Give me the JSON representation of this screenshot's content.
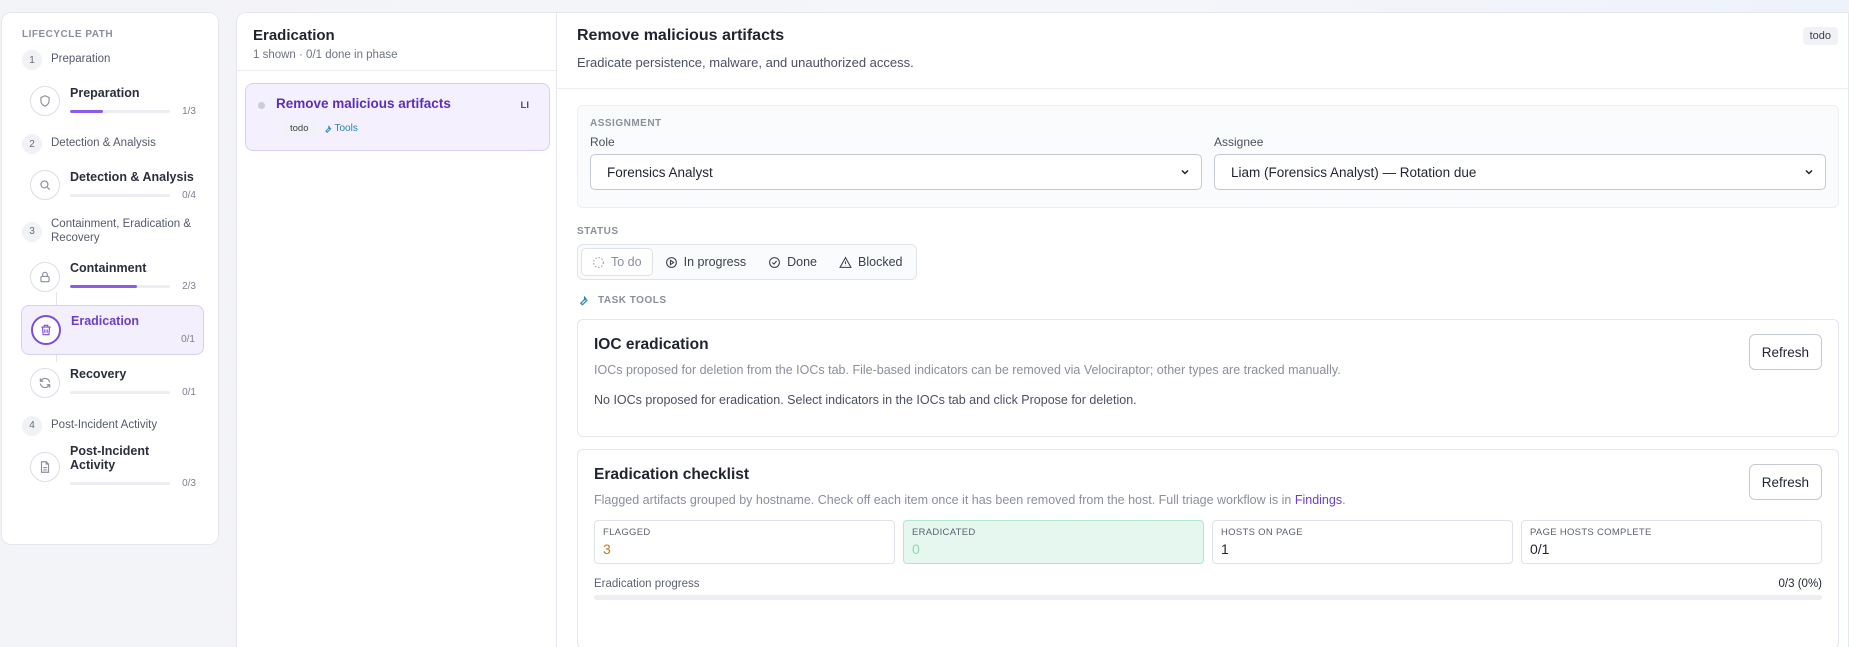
{
  "sidebar": {
    "title": "LIFECYCLE PATH",
    "phases": [
      {
        "num": "1",
        "name": "Preparation"
      },
      {
        "num": "2",
        "name": "Detection & Analysis"
      },
      {
        "num": "3",
        "name": "Containment, Eradication & Recovery"
      },
      {
        "num": "4",
        "name": "Post-Incident Activity"
      }
    ],
    "steps": [
      {
        "label": "Preparation",
        "count": "1/3",
        "progress": 0.33,
        "icon": "shield-icon"
      },
      {
        "label": "Detection & Analysis",
        "count": "0/4",
        "progress": 0,
        "icon": "search-icon"
      },
      {
        "label": "Containment",
        "count": "2/3",
        "progress": 0.67,
        "icon": "lock-icon"
      },
      {
        "label": "Eradication",
        "count": "0/1",
        "progress": 0,
        "icon": "trash-icon",
        "active": true
      },
      {
        "label": "Recovery",
        "count": "0/1",
        "progress": 0,
        "icon": "refresh-icon"
      },
      {
        "label": "Post-Incident Activity",
        "count": "0/3",
        "progress": 0,
        "icon": "document-icon"
      }
    ]
  },
  "tasks": {
    "title": "Eradication",
    "subtitle": "1 shown · 0/1 done in phase",
    "items": [
      {
        "name": "Remove malicious artifacts",
        "initials": "LI",
        "status": "todo",
        "tools": "Tools"
      }
    ]
  },
  "detail": {
    "title": "Remove malicious artifacts",
    "description": "Eradicate persistence, malware, and unauthorized access.",
    "status_badge": "todo",
    "assignment": {
      "section": "ASSIGNMENT",
      "role_label": "Role",
      "role_value": "Forensics Analyst",
      "assignee_label": "Assignee",
      "assignee_value": "Liam (Forensics Analyst) — Rotation due"
    },
    "status": {
      "section": "STATUS",
      "options": [
        "To do",
        "In progress",
        "Done",
        "Blocked"
      ],
      "selected": "To do"
    },
    "tools_section": "TASK TOOLS",
    "ioc": {
      "title": "IOC eradication",
      "description": "IOCs proposed for deletion from the IOCs tab. File-based indicators can be removed via Velociraptor; other types are tracked manually.",
      "note": "No IOCs proposed for eradication. Select indicators in the IOCs tab and click Propose for deletion.",
      "refresh": "Refresh"
    },
    "checklist": {
      "title": "Eradication checklist",
      "description_prefix": "Flagged artifacts grouped by hostname. Check off each item once it has been removed from the host. Full triage workflow is in ",
      "link": "Findings",
      "description_suffix": ".",
      "refresh": "Refresh",
      "stats": [
        {
          "label": "FLAGGED",
          "value": "3"
        },
        {
          "label": "ERADICATED",
          "value": "0"
        },
        {
          "label": "HOSTS ON PAGE",
          "value": "1"
        },
        {
          "label": "PAGE HOSTS COMPLETE",
          "value": "0/1"
        }
      ],
      "progress_label": "Eradication progress",
      "progress_value": "0/3 (0%)",
      "progress": 0
    }
  },
  "colors": {
    "accent": "#7c4fd6",
    "accent_text": "#5b2fb8",
    "link_blue": "#2683b8",
    "orange": "#c9751c",
    "green_bg": "#e6f7f0"
  }
}
